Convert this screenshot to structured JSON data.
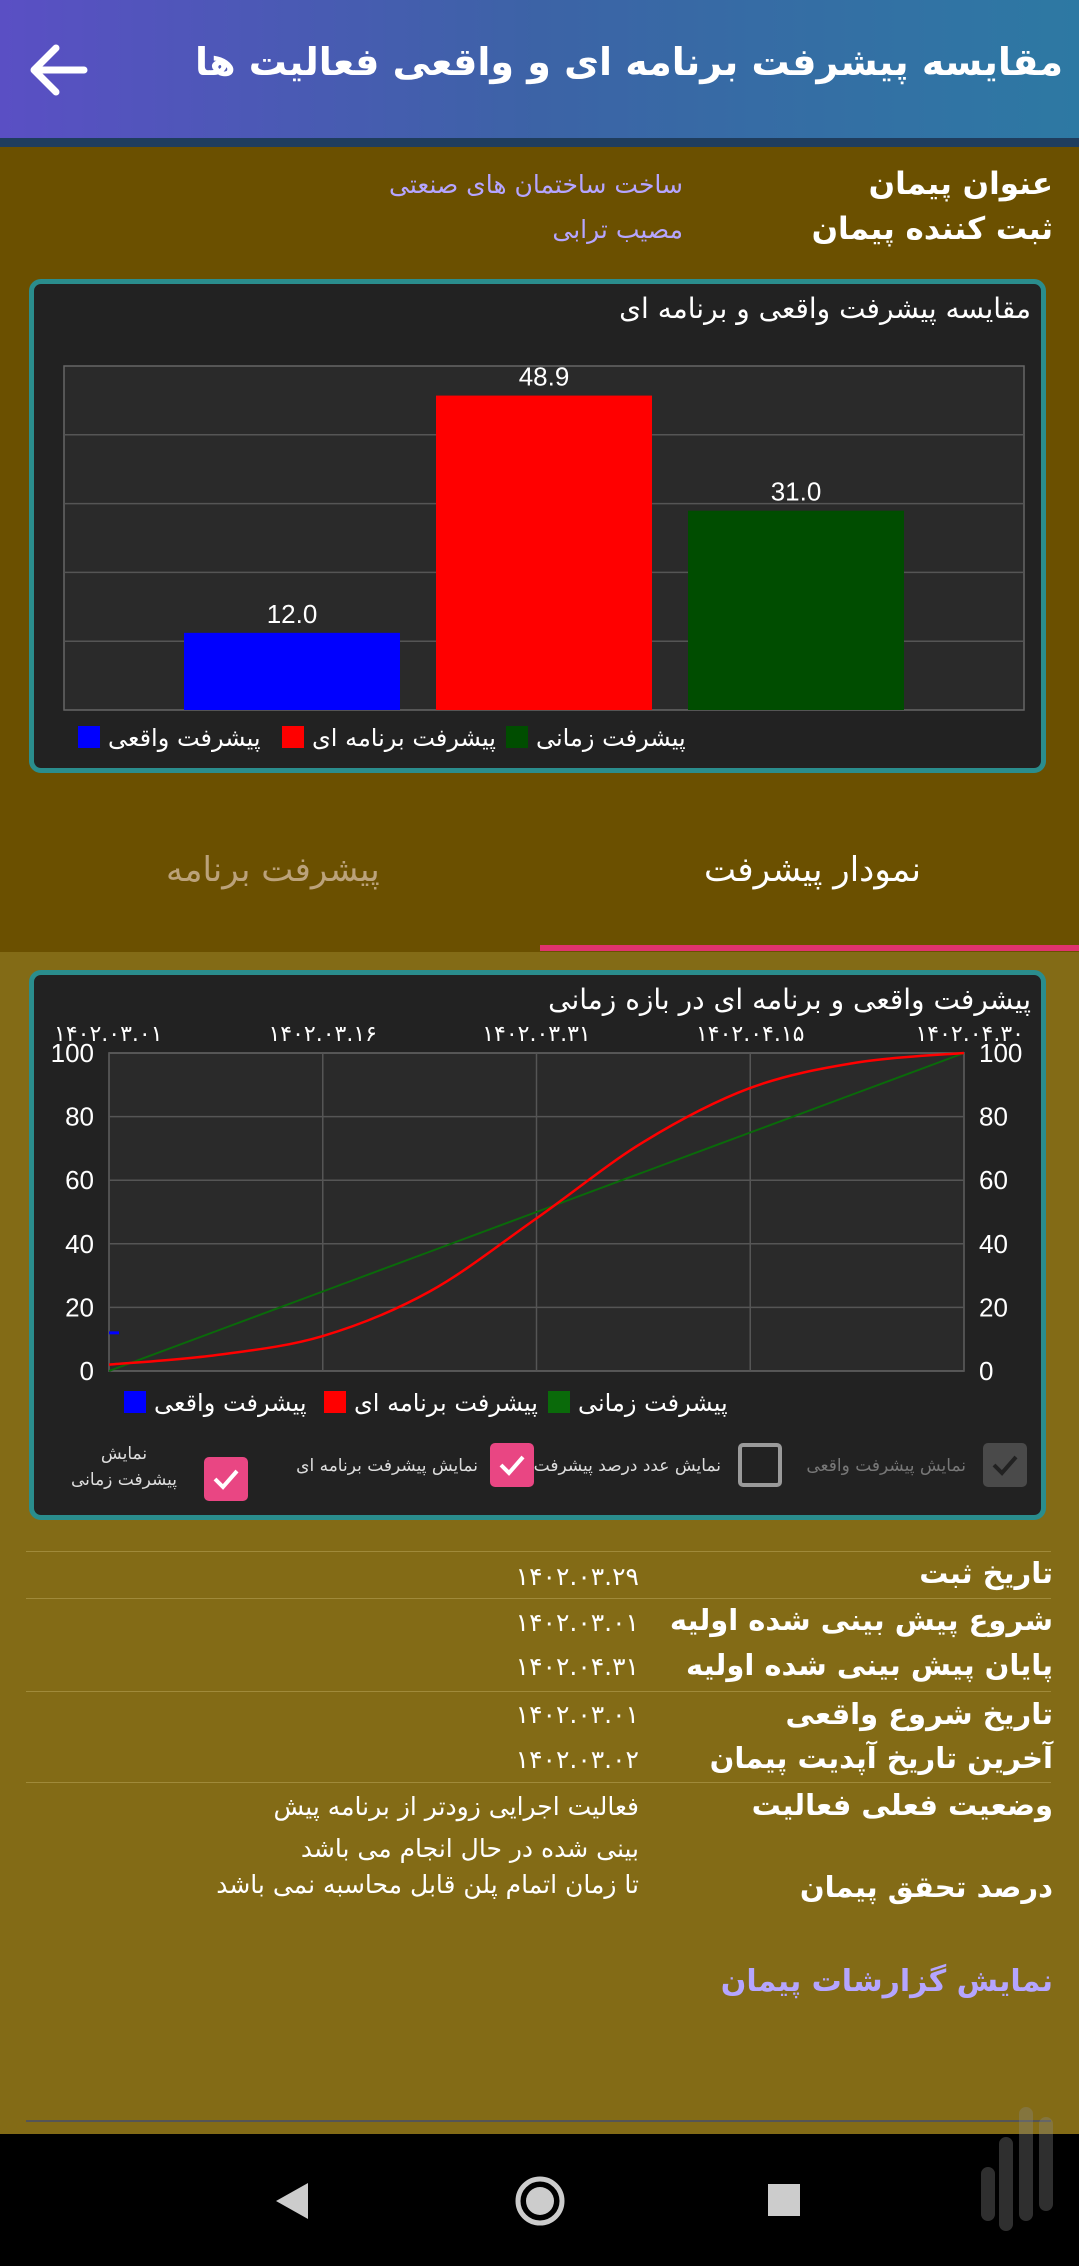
{
  "header": {
    "title": "مقایسه پیشرفت برنامه ای و واقعی فعالیت ها",
    "back_icon": "arrow-left-icon"
  },
  "info": {
    "contract_title_label": "عنوان پیمان",
    "contract_title_value": "ساخت ساختمان های صنعتی",
    "registrar_label": "ثبت کننده پیمان",
    "registrar_value": "مصیب ترابی"
  },
  "bar_chart_card": {
    "title": "مقایسه پیشرفت واقعی و برنامه ای"
  },
  "tabs": [
    {
      "label": "نمودار پیشرفت",
      "selected": true
    },
    {
      "label": "پیشرفت برنامه",
      "selected": false
    }
  ],
  "line_chart_card": {
    "title": "پیشرفت واقعی و برنامه ای در بازه زمانی"
  },
  "checkboxes": [
    {
      "label": "نمایش پیشرفت واقعی",
      "checked": true,
      "disabled": true
    },
    {
      "label": "نمایش عدد درصد پیشرفت",
      "checked": false,
      "disabled": false
    },
    {
      "label": "نمایش پیشرفت برنامه ای",
      "checked": true,
      "disabled": false
    },
    {
      "label": "نمایش پیشرفت زمانی",
      "checked": true,
      "disabled": false
    }
  ],
  "details": [
    {
      "label": "تاریخ ثبت",
      "value": "۱۴۰۲.۰۳.۲۹"
    },
    {
      "label": "شروع پیش بینی شده اولیه",
      "value": "۱۴۰۲.۰۳.۰۱"
    },
    {
      "label": "پایان پیش بینی شده اولیه",
      "value": "۱۴۰۲.۰۴.۳۱"
    },
    {
      "label": "تاریخ شروع واقعی",
      "value": "۱۴۰۲.۰۳.۰۱"
    },
    {
      "label": "آخرین تاریخ آپدیت پیمان",
      "value": "۱۴۰۲.۰۳.۰۲"
    },
    {
      "label": "وضعیت فعلی فعالیت",
      "value": "فعالیت اجرایی زودتر از برنامه پیش بینی شده در حال انجام می باشد"
    },
    {
      "label": "درصد تحقق پیمان",
      "value": "تا زمان اتمام پلن قابل محاسبه نمی باشد"
    }
  ],
  "reports_link": "نمایش گزارشات پیمان",
  "colors": {
    "real": "#0000ff",
    "planned": "#ff0000",
    "time": "#004d00",
    "accent": "#e94683"
  },
  "chart_data": [
    {
      "type": "bar",
      "title": "مقایسه پیشرفت واقعی و برنامه ای",
      "series": [
        {
          "name": "پیشرفت واقعی",
          "value": 12.0,
          "color": "#0000ff"
        },
        {
          "name": "پیشرفت برنامه ای",
          "value": 48.9,
          "color": "#ff0000"
        },
        {
          "name": "پیشرفت زمانی",
          "value": 31.0,
          "color": "#004d00"
        }
      ],
      "value_labels": [
        "12.0",
        "48.9",
        "31.0"
      ],
      "ylim": [
        0,
        53.5
      ],
      "grid": true,
      "legend": "bottom"
    },
    {
      "type": "line",
      "title": "پیشرفت واقعی و برنامه ای در بازه زمانی",
      "x_ticks": [
        "۱۴۰۲.۰۳.۰۱",
        "۱۴۰۲.۰۳.۱۶",
        "۱۴۰۲.۰۳.۳۱",
        "۱۴۰۲.۰۴.۱۵",
        "۱۴۰۲.۰۴.۳۰"
      ],
      "y_ticks": [
        "0",
        "20",
        "40",
        "60",
        "80",
        "100"
      ],
      "ylim": [
        0,
        100
      ],
      "x": [
        "۱۴۰۲.۰۳.۰۱",
        "۱۴۰۲.۰۳.۰۸",
        "۱۴۰۲.۰۳.۱۶",
        "۱۴۰۲.۰۳.۲۳",
        "۱۴۰۲.۰۳.۳۱",
        "۱۴۰۲.۰۴.۰۸",
        "۱۴۰۲.۰۴.۱۵",
        "۱۴۰۲.۰۴.۲۳",
        "۱۴۰۲.۰۴.۳۰"
      ],
      "series": [
        {
          "name": "پیشرفت واقعی",
          "color": "#0000ff",
          "values": [
            12,
            null,
            null,
            null,
            null,
            null,
            null,
            null,
            null
          ]
        },
        {
          "name": "پیشرفت برنامه ای",
          "color": "#ff0000",
          "values": [
            2,
            5,
            11,
            25,
            48,
            72,
            89,
            97,
            100
          ]
        },
        {
          "name": "پیشرفت زمانی",
          "color": "#0a6a0a",
          "values": [
            0,
            12.5,
            25,
            37.5,
            50,
            62.5,
            75,
            87.5,
            100
          ]
        }
      ],
      "grid": true,
      "legend": "bottom"
    }
  ]
}
